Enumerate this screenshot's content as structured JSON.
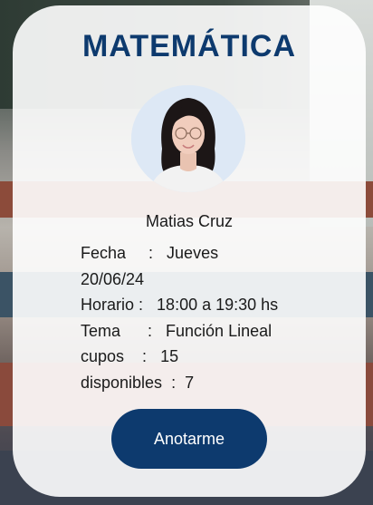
{
  "card": {
    "title": "MATEMÁTICA",
    "teacher_name": "Matias Cruz",
    "info": {
      "fecha_label": "Fecha",
      "fecha_value": "Jueves",
      "fecha_date": "20/06/24",
      "horario_label": "Horario",
      "horario_value": "18:00 a 19:30 hs",
      "tema_label": "Tema",
      "tema_value": "Función Lineal",
      "cupos_label": "cupos",
      "cupos_value": "15",
      "disponibles_label": "disponibles",
      "disponibles_value": "7"
    },
    "button_label": "Anotarme"
  },
  "colors": {
    "accent": "#0d3a6e",
    "card_bg": "#ffffff"
  },
  "icons": {
    "avatar": "teacher-photo"
  }
}
